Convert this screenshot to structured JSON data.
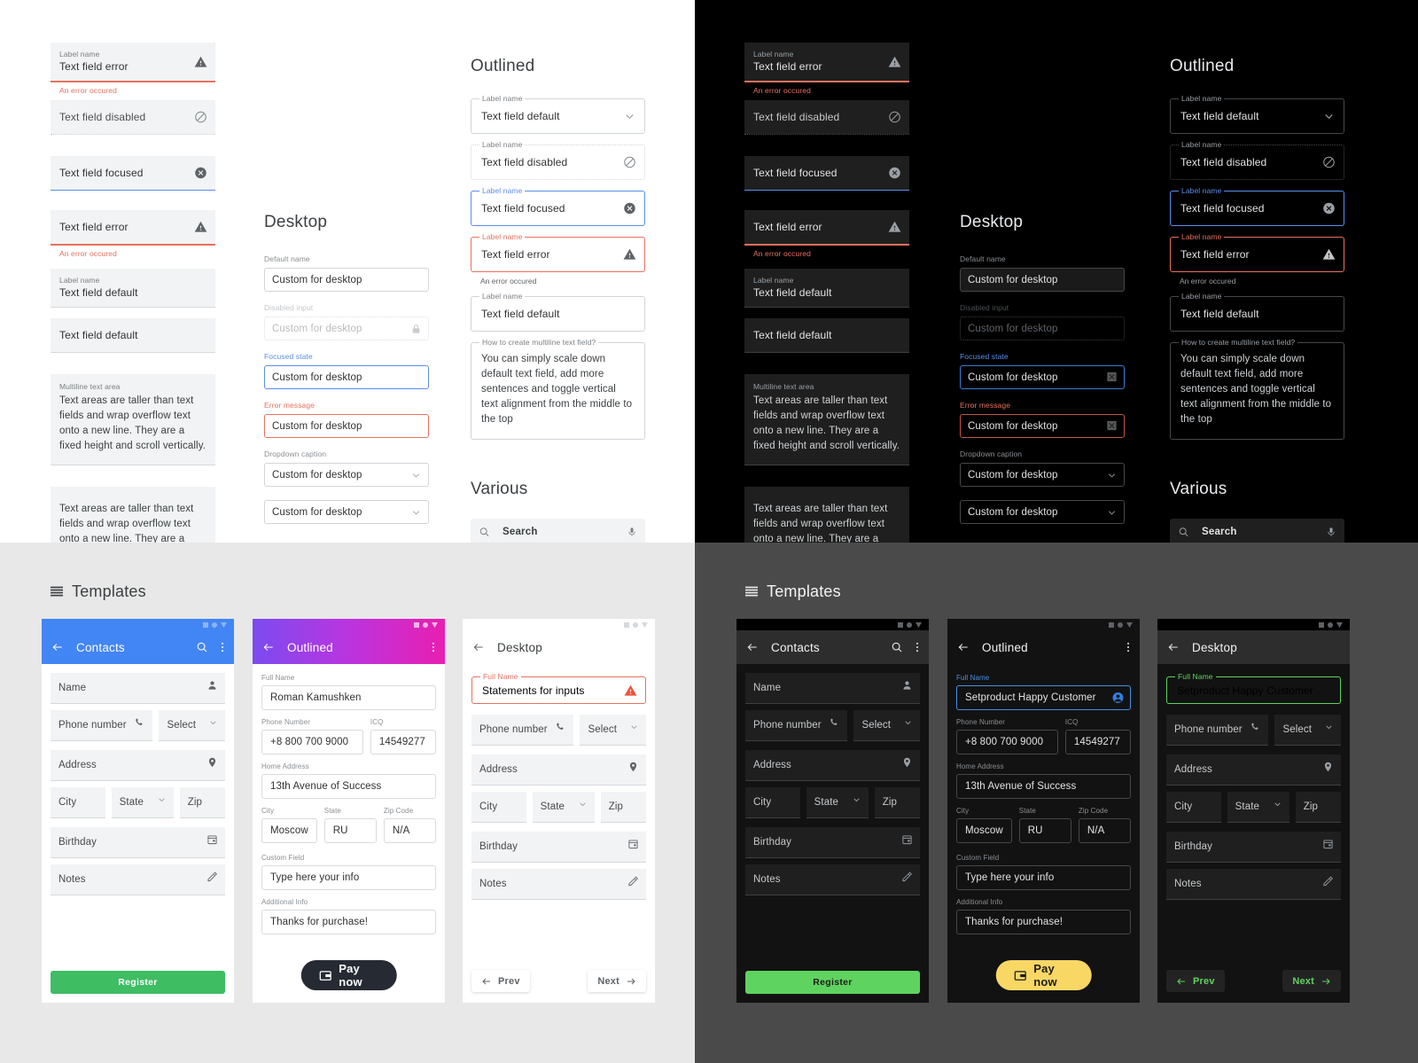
{
  "colors": {
    "accent_blue": "#5b8def",
    "error_red": "#e8715f",
    "green": "#3ebd63",
    "dark_green": "#5fd35f",
    "yellow": "#f6d濾"
  },
  "light_fields": {
    "filled": [
      {
        "label": "Label name",
        "value": "Text field error",
        "icon": "warning-icon",
        "state": "error",
        "helper": "An error occured"
      },
      {
        "label": "",
        "value": "Text field disabled",
        "icon": "block-icon",
        "state": "disabled",
        "helper": ""
      },
      {
        "label": "",
        "value": "Text field focused",
        "icon": "clear-circle-icon",
        "state": "focused",
        "helper": ""
      },
      {
        "label": "",
        "value": "Text field error",
        "icon": "warning-icon",
        "state": "error",
        "helper": "An error occured"
      },
      {
        "label": "Label name",
        "value": "Text field default",
        "icon": "",
        "state": "default",
        "helper": ""
      },
      {
        "label": "",
        "value": "Text field default",
        "icon": "",
        "state": "default",
        "helper": ""
      }
    ],
    "textareas": [
      {
        "label": "Multiline text area",
        "text": "Text areas are taller than text fields and wrap overflow text onto a new line. They are a fixed height and scroll vertically."
      },
      {
        "label": "",
        "text": "Text areas are taller than text fields and wrap overflow text onto a new line. They are a fixed height and scroll vertically."
      }
    ]
  },
  "desktop_column": {
    "title": "Desktop",
    "fields": [
      {
        "label": "Default name",
        "value": "Custom for desktop",
        "state": "default",
        "icon": ""
      },
      {
        "label": "Disabled input",
        "value": "Custom for desktop",
        "state": "disabled",
        "icon": "lock-icon"
      },
      {
        "label": "Focused state",
        "value": "Custom for desktop",
        "state": "focused",
        "icon": ""
      },
      {
        "label": "Error message",
        "value": "Custom for desktop",
        "state": "error",
        "icon": ""
      },
      {
        "label": "Dropdown caption",
        "value": "Custom for desktop",
        "state": "dropdown",
        "icon": "chevron-down-icon"
      },
      {
        "label": "",
        "value": "Custom for desktop",
        "state": "dropdown",
        "icon": "chevron-down-icon"
      }
    ]
  },
  "desktop_column_dark": {
    "title": "Desktop",
    "fields": [
      {
        "label": "Default name",
        "value": "Custom for desktop",
        "state": "default",
        "icon": ""
      },
      {
        "label": "Disabled input",
        "value": "Custom for desktop",
        "state": "disabled",
        "icon": ""
      },
      {
        "label": "Focused state",
        "value": "Custom for desktop",
        "state": "focused",
        "icon": "close-box-icon"
      },
      {
        "label": "Error message",
        "value": "Custom for desktop",
        "state": "error",
        "icon": "close-box-icon"
      },
      {
        "label": "Dropdown caption",
        "value": "Custom for desktop",
        "state": "dropdown",
        "icon": "chevron-down-icon"
      },
      {
        "label": "",
        "value": "Custom for desktop",
        "state": "dropdown",
        "icon": "chevron-down-icon"
      }
    ]
  },
  "outlined_column": {
    "title": "Outlined",
    "fields": [
      {
        "label": "Label name",
        "value": "Text field default",
        "state": "default",
        "icon": "chevron-down-icon",
        "helper": ""
      },
      {
        "label": "Label name",
        "value": "Text field disabled",
        "state": "disabled",
        "icon": "block-icon",
        "helper": ""
      },
      {
        "label": "Label name",
        "value": "Text field focused",
        "state": "focused",
        "icon": "clear-circle-icon",
        "helper": ""
      },
      {
        "label": "Label name",
        "value": "Text field error",
        "state": "error",
        "icon": "warning-icon",
        "helper": "An error occured"
      },
      {
        "label": "Label name",
        "value": "Text field default",
        "state": "default",
        "icon": "",
        "helper": ""
      }
    ],
    "textarea": {
      "label": "How to create multiline text field?",
      "text": "You can simply scale down default text field, add more sentences and toggle vertical text alignment from the middle to the top"
    },
    "various_title": "Various",
    "search": {
      "label": "Search",
      "left_icon": "search-icon",
      "right_icon": "microphone-icon"
    }
  },
  "templates": {
    "title": "Templates",
    "icon": "hamburger-icon",
    "contacts": {
      "appbar": {
        "title": "Contacts",
        "back_icon": "arrow-back-icon",
        "search_icon": "search-icon",
        "more_icon": "more-vertical-icon"
      },
      "fields": [
        {
          "label": "Name",
          "icon": "person-icon"
        },
        {
          "label": "Phone number",
          "icon": "phone-icon"
        },
        {
          "label": "Select",
          "icon": "chevron-down-icon"
        },
        {
          "label": "Address",
          "icon": "location-pin-icon"
        },
        {
          "label": "City",
          "icon": ""
        },
        {
          "label": "State",
          "icon": "chevron-down-icon"
        },
        {
          "label": "Zip",
          "icon": ""
        },
        {
          "label": "Birthday",
          "icon": "calendar-icon"
        },
        {
          "label": "Notes",
          "icon": "pencil-icon"
        }
      ],
      "button": "Register"
    },
    "outlined": {
      "appbar": {
        "title": "Outlined",
        "back_icon": "arrow-back-icon",
        "more_icon": "more-vertical-icon"
      },
      "fields": [
        {
          "label": "Full Name",
          "value": "Roman Kamushken"
        },
        {
          "label": "Phone Number",
          "value": "+8 800 700 9000"
        },
        {
          "label": "ICQ",
          "value": "14549277"
        },
        {
          "label": "Home Address",
          "value": "13th Avenue of Success"
        },
        {
          "label": "City",
          "value": "Moscow"
        },
        {
          "label": "State",
          "value": "RU"
        },
        {
          "label": "Zip Code",
          "value": "N/A"
        },
        {
          "label": "Custom Field",
          "value": "Type here your info"
        },
        {
          "label": "Additional Info",
          "value": "Thanks for purchase!"
        }
      ],
      "button": "Pay now",
      "button_icon": "wallet-icon"
    },
    "outlined_dark": {
      "appbar": {
        "title": "Outlined",
        "back_icon": "arrow-back-icon",
        "more_icon": "more-vertical-icon"
      },
      "fields": [
        {
          "label": "Full Name",
          "value": "Setproduct Happy Customer"
        },
        {
          "label": "Phone Number",
          "value": "+8 800 700 9000"
        },
        {
          "label": "ICQ",
          "value": "14549277"
        },
        {
          "label": "Home Address",
          "value": "13th Avenue of Success"
        },
        {
          "label": "City",
          "value": "Moscow"
        },
        {
          "label": "State",
          "value": "RU"
        },
        {
          "label": "Zip Code",
          "value": "N/A"
        },
        {
          "label": "Custom Field",
          "value": "Type here your info"
        },
        {
          "label": "Additional Info",
          "value": "Thanks for purchase!"
        }
      ],
      "button": "Pay now",
      "button_icon": "wallet-icon"
    },
    "desktop": {
      "appbar": {
        "title": "Desktop",
        "back_icon": "arrow-back-icon"
      },
      "error_field": {
        "label": "Full Name",
        "value": "Statements for inputs",
        "icon": "warning-icon"
      },
      "fields": [
        {
          "label": "Phone number",
          "icon": "phone-icon"
        },
        {
          "label": "Select",
          "icon": "chevron-down-icon"
        },
        {
          "label": "Address",
          "icon": "location-pin-icon"
        },
        {
          "label": "City",
          "icon": ""
        },
        {
          "label": "State",
          "icon": "chevron-down-icon"
        },
        {
          "label": "Zip",
          "icon": ""
        },
        {
          "label": "Birthday",
          "icon": "calendar-icon"
        },
        {
          "label": "Notes",
          "icon": "pencil-icon"
        }
      ],
      "prev": "Prev",
      "next": "Next"
    },
    "desktop_dark": {
      "appbar": {
        "title": "Desktop",
        "back_icon": "arrow-back-icon"
      },
      "error_field": {
        "label": "Full Name",
        "value": "Setproduct Happy Customer",
        "icon": ""
      },
      "prev": "Prev",
      "next": "Next"
    }
  }
}
